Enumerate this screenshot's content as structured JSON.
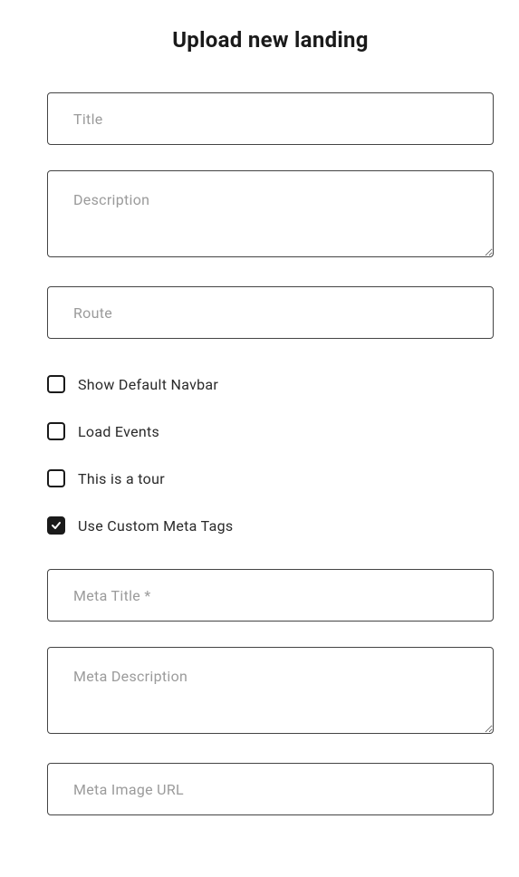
{
  "title": "Upload new landing",
  "fields": {
    "title_placeholder": "Title",
    "description_placeholder": "Description",
    "route_placeholder": "Route",
    "meta_title_placeholder": "Meta Title *",
    "meta_description_placeholder": "Meta Description",
    "meta_image_url_placeholder": "Meta Image URL"
  },
  "checkboxes": {
    "show_navbar": {
      "label": "Show Default Navbar",
      "checked": false
    },
    "load_events": {
      "label": "Load Events",
      "checked": false
    },
    "is_tour": {
      "label": "This is a tour",
      "checked": false
    },
    "custom_meta": {
      "label": "Use Custom Meta Tags",
      "checked": true
    }
  }
}
